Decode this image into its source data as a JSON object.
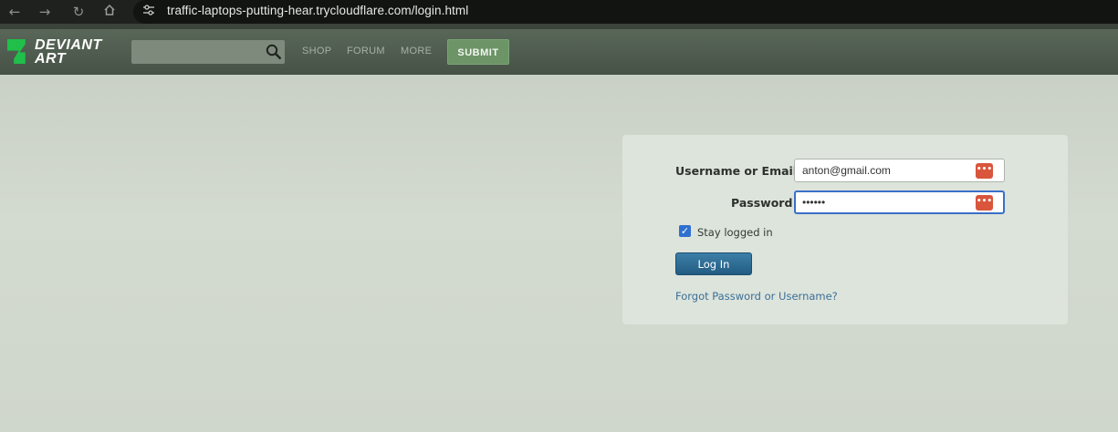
{
  "browser": {
    "url": "traffic-laptops-putting-hear.trycloudflare.com/login.html"
  },
  "header": {
    "logo_line1": "DEVIANT",
    "logo_line2": "ART",
    "nav": [
      "SHOP",
      "FORUM",
      "MORE"
    ],
    "submit_label": "SUBMIT",
    "colors": {
      "header": "#4f5c4f",
      "submit": "#6c9466"
    }
  },
  "login": {
    "username_label": "Username or Email",
    "username_value": "anton@gmail.com",
    "password_label": "Password",
    "password_value": "••••••",
    "remember_label": "Stay logged in",
    "remember_checked": true,
    "login_button": "Log In",
    "forgot_link": "Forgot Password or Username?"
  }
}
